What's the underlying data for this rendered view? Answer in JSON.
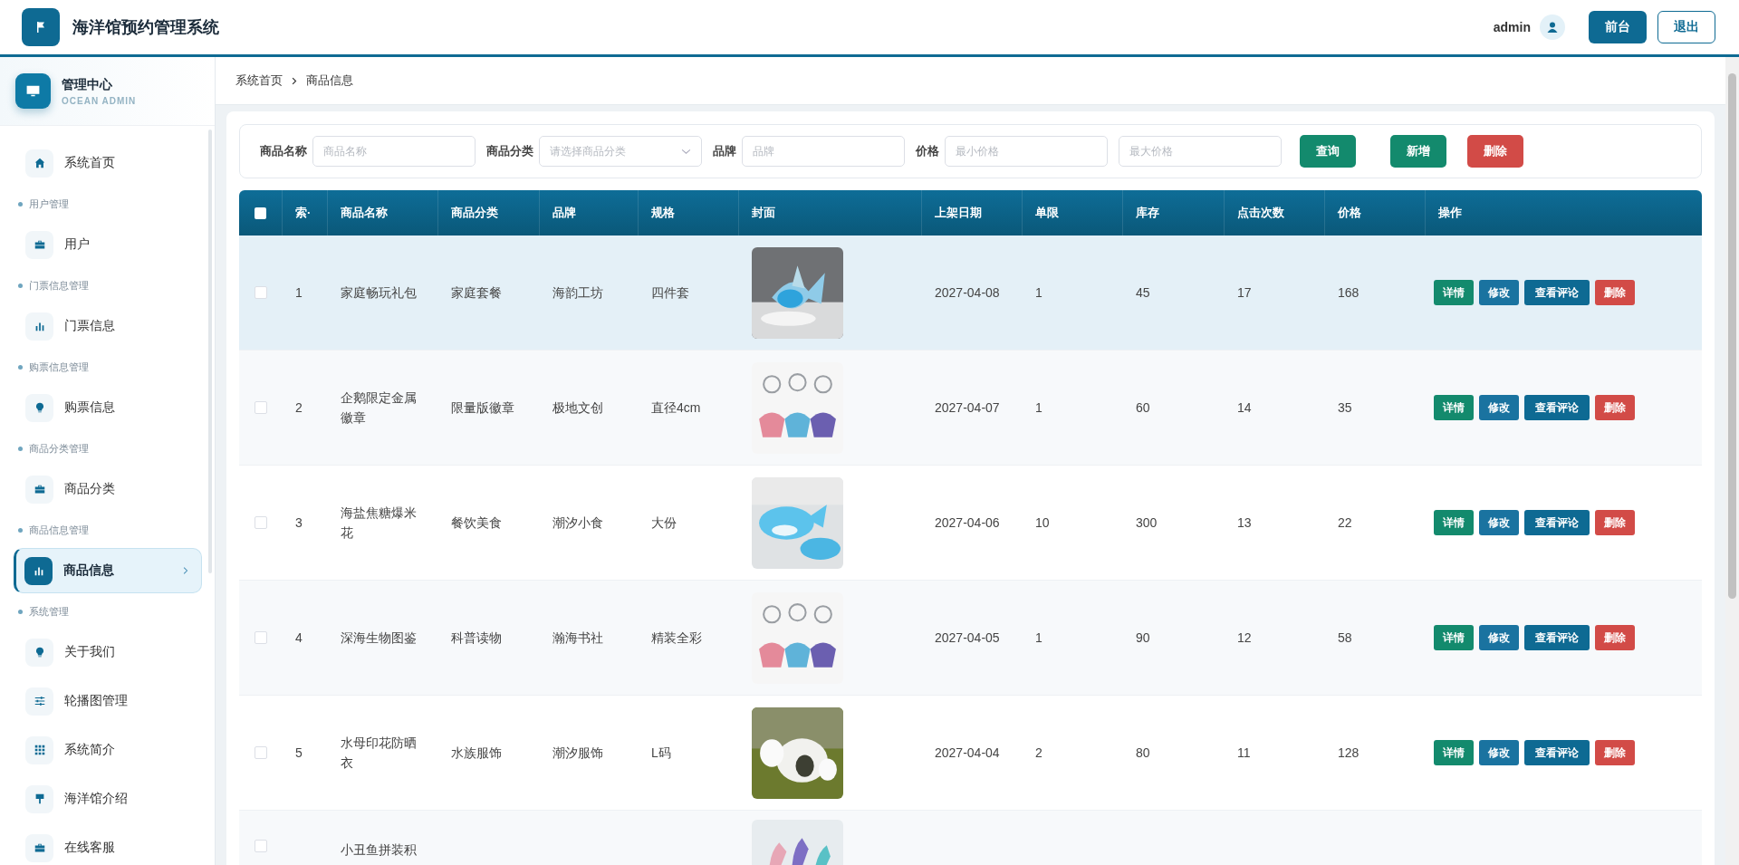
{
  "header": {
    "title": "海洋馆预约管理系统",
    "username": "admin",
    "buttons": [
      {
        "label": "前台",
        "kind": "primary"
      },
      {
        "label": "退出",
        "kind": "outline"
      }
    ]
  },
  "sidebar": {
    "title": "管理中心",
    "subtitle": "OCEAN ADMIN",
    "items": [
      {
        "kind": "link",
        "label": "系统首页",
        "selected": false
      },
      {
        "kind": "group",
        "label": "用户管理"
      },
      {
        "kind": "link",
        "label": "用户",
        "selected": false
      },
      {
        "kind": "group",
        "label": "门票信息管理"
      },
      {
        "kind": "link",
        "label": "门票信息",
        "selected": false
      },
      {
        "kind": "group",
        "label": "购票信息管理"
      },
      {
        "kind": "link",
        "label": "购票信息",
        "selected": false
      },
      {
        "kind": "group",
        "label": "商品分类管理"
      },
      {
        "kind": "link",
        "label": "商品分类",
        "selected": false
      },
      {
        "kind": "group",
        "label": "商品信息管理"
      },
      {
        "kind": "link",
        "label": "商品信息",
        "selected": true
      },
      {
        "kind": "group",
        "label": "系统管理"
      },
      {
        "kind": "link",
        "label": "关于我们",
        "selected": false
      },
      {
        "kind": "link",
        "label": "轮播图管理",
        "selected": false
      },
      {
        "kind": "link",
        "label": "系统简介",
        "selected": false
      },
      {
        "kind": "link",
        "label": "海洋馆介绍",
        "selected": false
      },
      {
        "kind": "link",
        "label": "在线客服",
        "selected": false
      }
    ]
  },
  "breadcrumb": [
    "系统首页",
    "商品信息"
  ],
  "search": {
    "fields": [
      {
        "kind": "input",
        "label": "商品名称",
        "placeholder": "商品名称"
      },
      {
        "kind": "select",
        "label": "商品分类",
        "placeholder": "请选择商品分类"
      },
      {
        "kind": "input",
        "label": "品牌",
        "placeholder": "品牌"
      },
      {
        "kind": "input",
        "label": "价格",
        "placeholder": "最小价格"
      },
      {
        "kind": "input",
        "placeholder": "最大价格"
      }
    ],
    "buttons": [
      {
        "label": "查询",
        "kind": "success"
      },
      {
        "label": "新增",
        "kind": "success"
      },
      {
        "label": "删除",
        "kind": "danger"
      }
    ]
  },
  "table": {
    "select_all_checked": false,
    "columns": [
      "索·",
      "商品名称",
      "商品分类",
      "品牌",
      "规格",
      "封面",
      "上架日期",
      "单限",
      "库存",
      "点击次数",
      "价格",
      "操作"
    ],
    "rows": [
      {
        "checked": false,
        "highlighted": true,
        "cells": {
          "index": "1",
          "name": "家庭畅玩礼包",
          "category": "家庭套餐",
          "brand": "海韵工坊",
          "spec": "四件套",
          "date": "2027-04-08",
          "limit": "1",
          "stock": "45",
          "clicks": "17",
          "price": "168"
        },
        "actions": [
          {
            "label": "详情",
            "kind": "detail"
          },
          {
            "label": "修改",
            "kind": "edit"
          },
          {
            "label": "查看评论",
            "kind": "comments"
          },
          {
            "label": "删除",
            "kind": "delete"
          }
        ]
      },
      {
        "checked": false,
        "highlighted": false,
        "cells": {
          "index": "2",
          "name": "企鹅限定金属徽章",
          "category": "限量版徽章",
          "brand": "极地文创",
          "spec": "直径4cm",
          "date": "2027-04-07",
          "limit": "1",
          "stock": "60",
          "clicks": "14",
          "price": "35"
        },
        "actions": [
          {
            "label": "详情",
            "kind": "detail"
          },
          {
            "label": "修改",
            "kind": "edit"
          },
          {
            "label": "查看评论",
            "kind": "comments"
          },
          {
            "label": "删除",
            "kind": "delete"
          }
        ]
      },
      {
        "checked": false,
        "highlighted": false,
        "cells": {
          "index": "3",
          "name": "海盐焦糖爆米花",
          "category": "餐饮美食",
          "brand": "潮汐小食",
          "spec": "大份",
          "date": "2027-04-06",
          "limit": "10",
          "stock": "300",
          "clicks": "13",
          "price": "22"
        },
        "actions": [
          {
            "label": "详情",
            "kind": "detail"
          },
          {
            "label": "修改",
            "kind": "edit"
          },
          {
            "label": "查看评论",
            "kind": "comments"
          },
          {
            "label": "删除",
            "kind": "delete"
          }
        ]
      },
      {
        "checked": false,
        "highlighted": false,
        "cells": {
          "index": "4",
          "name": "深海生物图鉴",
          "category": "科普读物",
          "brand": "瀚海书社",
          "spec": "精装全彩",
          "date": "2027-04-05",
          "limit": "1",
          "stock": "90",
          "clicks": "12",
          "price": "58"
        },
        "actions": [
          {
            "label": "详情",
            "kind": "detail"
          },
          {
            "label": "修改",
            "kind": "edit"
          },
          {
            "label": "查看评论",
            "kind": "comments"
          },
          {
            "label": "删除",
            "kind": "delete"
          }
        ]
      },
      {
        "checked": false,
        "highlighted": false,
        "cells": {
          "index": "5",
          "name": "水母印花防晒衣",
          "category": "水族服饰",
          "brand": "潮汐服饰",
          "spec": "L码",
          "date": "2027-04-04",
          "limit": "2",
          "stock": "80",
          "clicks": "11",
          "price": "128"
        },
        "actions": [
          {
            "label": "详情",
            "kind": "detail"
          },
          {
            "label": "修改",
            "kind": "edit"
          },
          {
            "label": "查看评论",
            "kind": "comments"
          },
          {
            "label": "删除",
            "kind": "delete"
          }
        ]
      },
      {
        "checked": false,
        "highlighted": false,
        "cells": {
          "name": "小丑鱼拼装积"
        }
      }
    ]
  }
}
